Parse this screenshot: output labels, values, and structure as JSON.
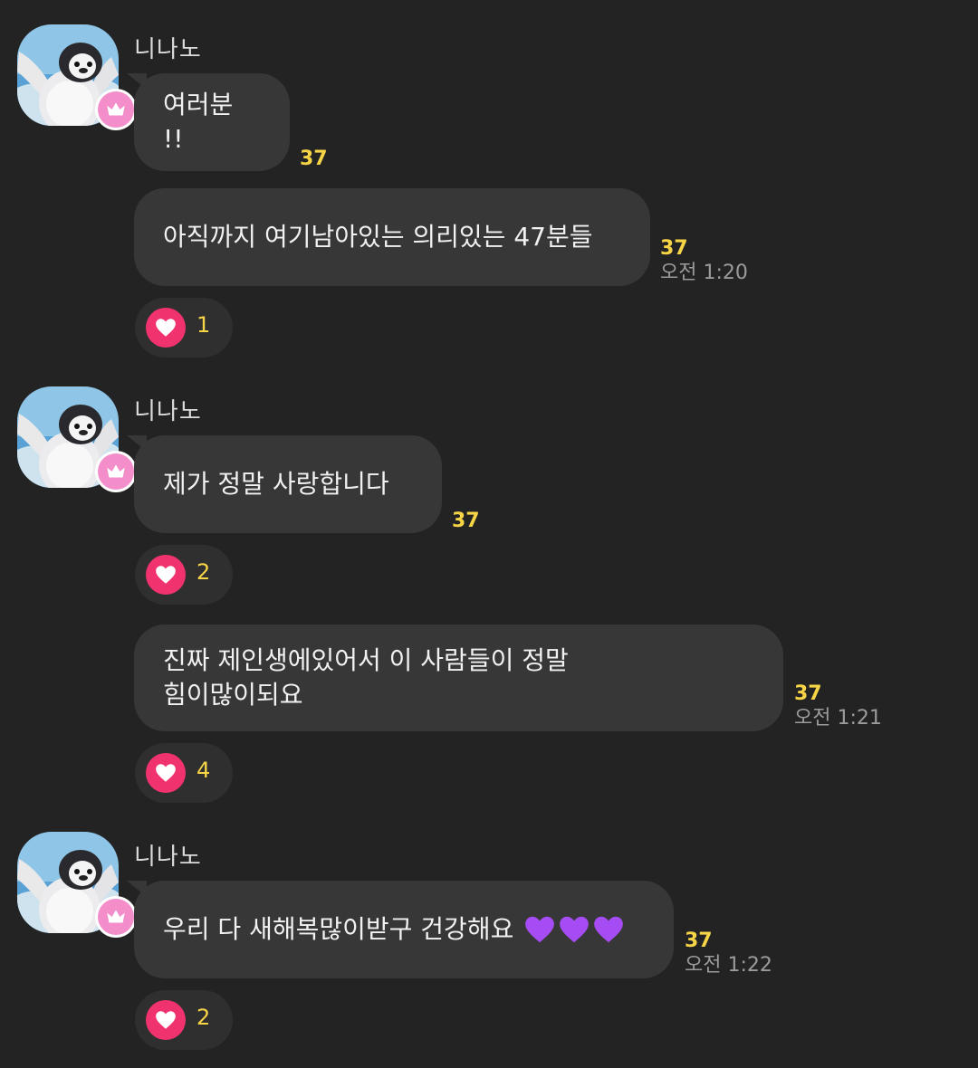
{
  "colors": {
    "background": "#232323",
    "bubble": "#373737",
    "unread": "#f7d547",
    "heart": "#f0336e",
    "badge": "#f38ecb",
    "emoji_heart": "#a64cf4"
  },
  "icons": {
    "badge": "crown-icon",
    "reaction": "heart-icon",
    "avatar": "penguin-avatar-icon"
  },
  "groups": [
    {
      "sender": "니나노",
      "messages": [
        {
          "text": "여러분 !!",
          "unread": "37",
          "time": ""
        },
        {
          "text": "아직까지 여기남아있는 의리있는 47분들",
          "unread": "37",
          "time": "오전 1:20",
          "reaction": "1"
        }
      ]
    },
    {
      "sender": "니나노",
      "messages": [
        {
          "text": "제가 정말 사랑합니다",
          "unread": "37",
          "time": "",
          "reaction": "2"
        },
        {
          "text": "진짜 제인생에있어서 이 사람들이 정말\n힘이많이되요",
          "unread": "37",
          "time": "오전 1:21",
          "reaction": "4"
        }
      ]
    },
    {
      "sender": "니나노",
      "messages": [
        {
          "text": "우리 다 새해복많이받구 건강해요",
          "emoji": "💜💜💜",
          "unread": "37",
          "time": "오전 1:22",
          "reaction": "2"
        }
      ]
    }
  ]
}
